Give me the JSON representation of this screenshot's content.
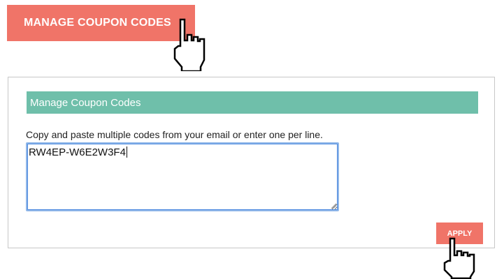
{
  "top_button": {
    "label": "MANAGE COUPON CODES"
  },
  "panel": {
    "header": "Manage Coupon Codes",
    "instructions": "Copy and paste multiple codes from your email or enter one per line.",
    "codes_value": "RW4EP-W6E2W3F4",
    "apply_label": "APPLY"
  },
  "icons": {
    "cursor": "hand-pointer-icon",
    "resize": "resize-grip-icon"
  },
  "colors": {
    "button": "#f07468",
    "header": "#6fbfaa",
    "focus": "#4d8ae0"
  }
}
